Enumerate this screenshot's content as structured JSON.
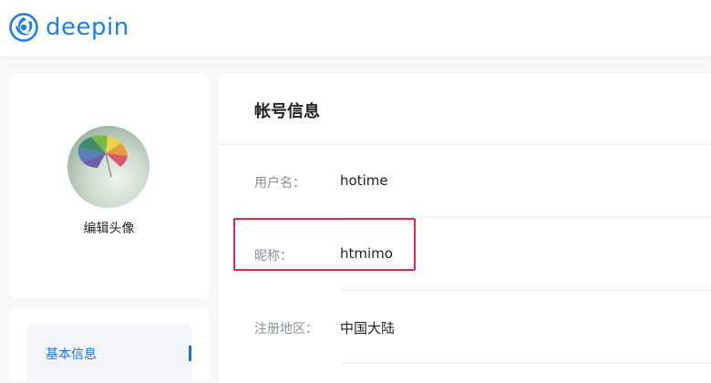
{
  "header": {
    "logo_text": "deepin",
    "logo_icon": "deepin-logo-icon",
    "brand_color": "#1f7fe0"
  },
  "profile": {
    "avatar_icon": "avatar-umbrella-image",
    "edit_avatar_label": "编辑头像"
  },
  "sidebar": {
    "items": [
      {
        "label": "基本信息",
        "active": true
      }
    ],
    "accent_color": "#1f6fd9"
  },
  "account": {
    "title": "帐号信息",
    "fields": [
      {
        "label": "用户名：",
        "value": "hotime"
      },
      {
        "label": "昵称：",
        "value": "htmimo"
      },
      {
        "label": "注册地区：",
        "value": "中国大陆"
      }
    ],
    "highlight_color": "#e8254f"
  }
}
